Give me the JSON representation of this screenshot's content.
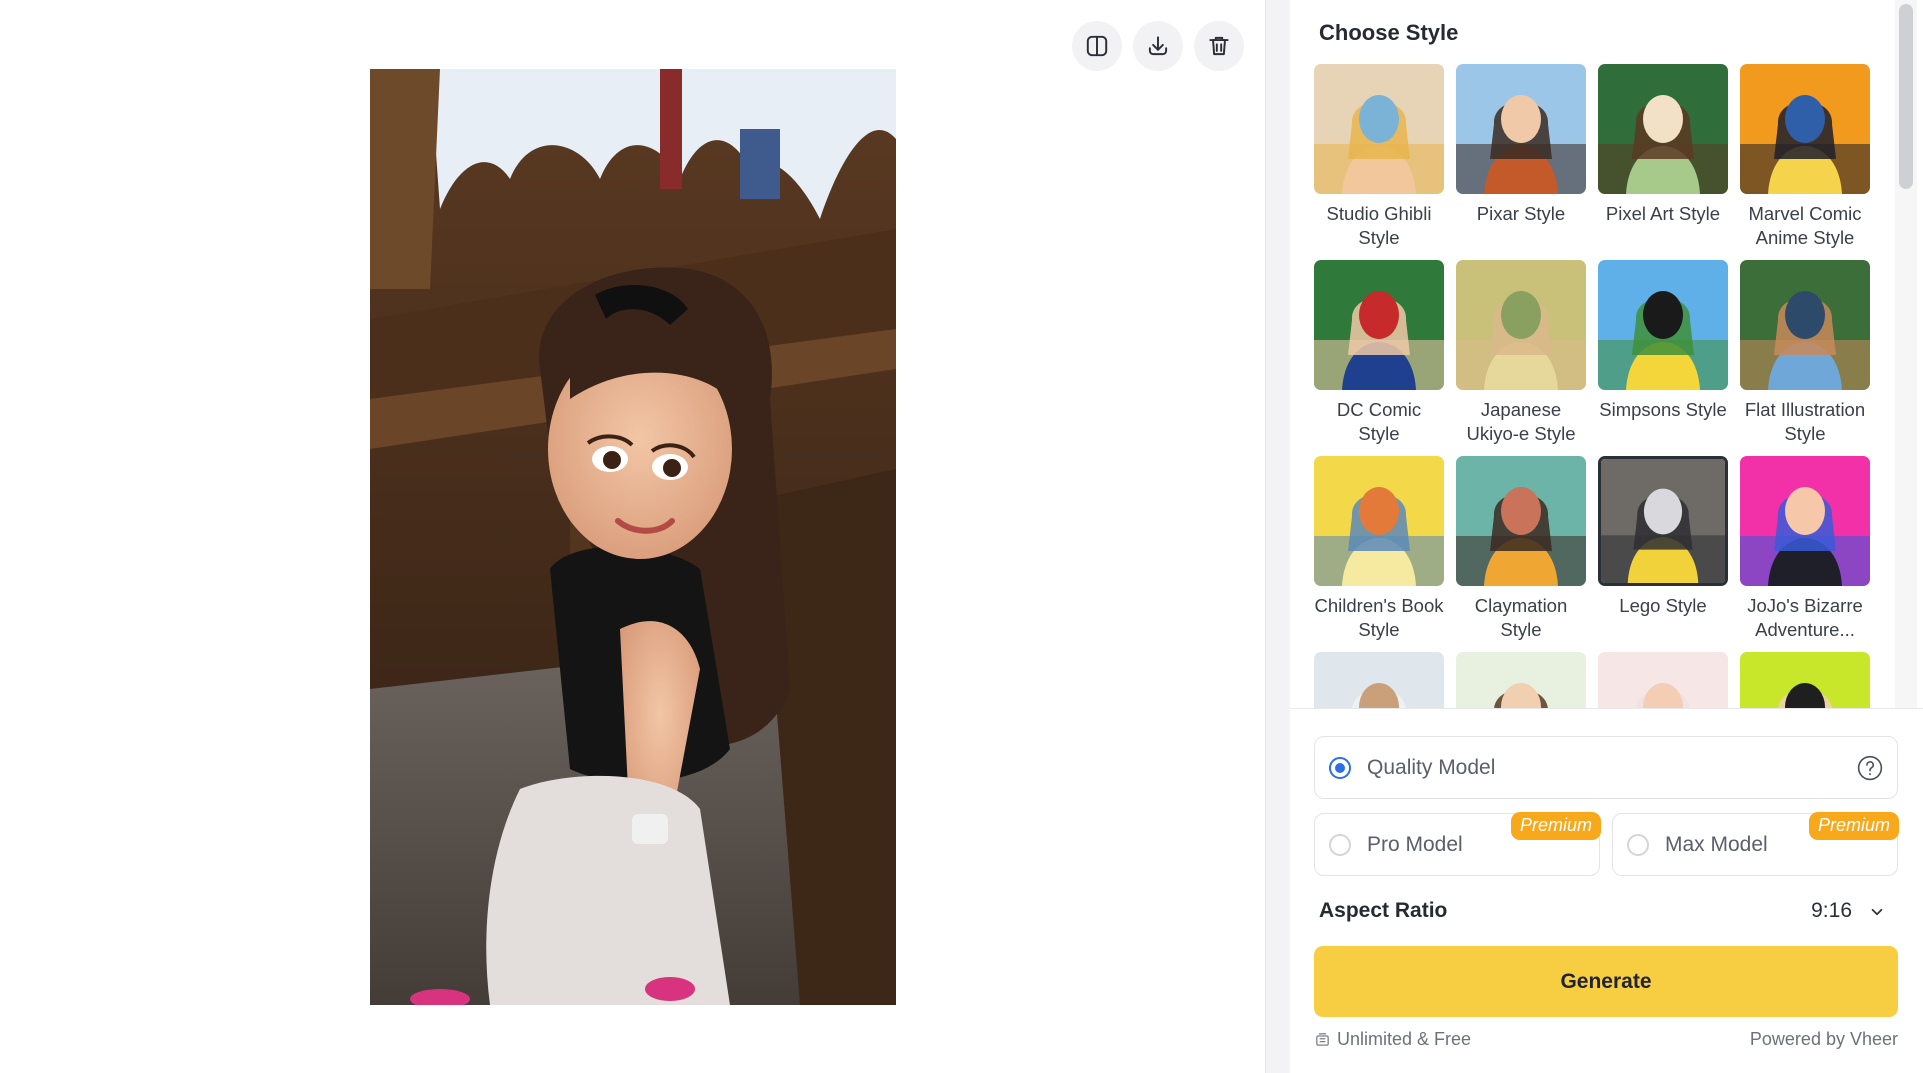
{
  "toolbar": {
    "compare_icon": "split-view-icon",
    "download_icon": "download-icon",
    "delete_icon": "trash-icon"
  },
  "preview": {
    "image_description": "stylized-portrait-result"
  },
  "styles_panel": {
    "title": "Choose Style",
    "selected_index": 10,
    "styles": [
      {
        "label": "Studio Ghibli\nStyle"
      },
      {
        "label": "Pixar Style"
      },
      {
        "label": "Pixel Art Style"
      },
      {
        "label": "Marvel Comic\nAnime Style"
      },
      {
        "label": "DC Comic Style"
      },
      {
        "label": "Japanese\nUkiyo-e Style"
      },
      {
        "label": "Simpsons Style"
      },
      {
        "label": "Flat Illustration\nStyle"
      },
      {
        "label": "Children's Book\nStyle"
      },
      {
        "label": "Claymation\nStyle"
      },
      {
        "label": "Lego Style"
      },
      {
        "label": "JoJo's Bizarre\nAdventure..."
      },
      {
        "label": ""
      },
      {
        "label": ""
      },
      {
        "label": ""
      },
      {
        "label": ""
      }
    ]
  },
  "models": {
    "quality": {
      "label": "Quality Model",
      "selected": true
    },
    "pro": {
      "label": "Pro Model",
      "badge": "Premium"
    },
    "max": {
      "label": "Max Model",
      "badge": "Premium"
    }
  },
  "aspect_ratio": {
    "label": "Aspect Ratio",
    "value": "9:16"
  },
  "generate": {
    "label": "Generate"
  },
  "footer": {
    "left": "Unlimited & Free",
    "right": "Powered by Vheer"
  },
  "colors": {
    "accent": "#f7cd42",
    "premium": "#f7a81b",
    "radio": "#2f6fe6"
  }
}
